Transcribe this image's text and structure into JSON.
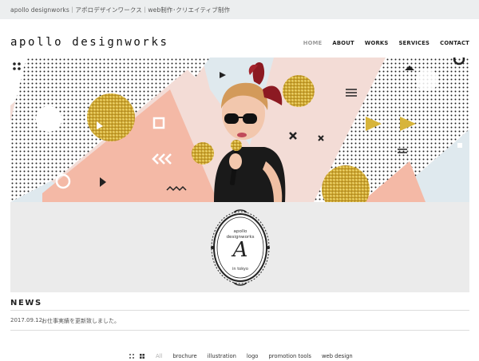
{
  "topbar": {
    "text": "apollo designworks｜アポロデザインワークス｜web制作･クリエイティブ制作"
  },
  "header": {
    "logo": "apollo designworks"
  },
  "nav": {
    "items": [
      "HOME",
      "ABOUT",
      "WORKS",
      "SERVICES",
      "CONTACT"
    ],
    "active": "HOME"
  },
  "emblem": {
    "line1": "apollo",
    "line2": "designworks",
    "letter": "A",
    "bottom": "in tokyo"
  },
  "news": {
    "title": "NEWS",
    "items": [
      {
        "date": "2017.09.12",
        "text": "お仕事実績を更新致しました。"
      }
    ]
  },
  "filters": {
    "icons": [
      "grid-small-icon",
      "grid-large-icon"
    ],
    "items": [
      "All",
      "brochure",
      "illustration",
      "logo",
      "promotion tools",
      "web design"
    ],
    "active": "All"
  },
  "colors": {
    "pink": "#f3dcd6",
    "salmon": "#f4b9a6",
    "lightblue": "#dfe9ee",
    "gold": "#d7b43a",
    "red_bow": "#8c1a22"
  }
}
